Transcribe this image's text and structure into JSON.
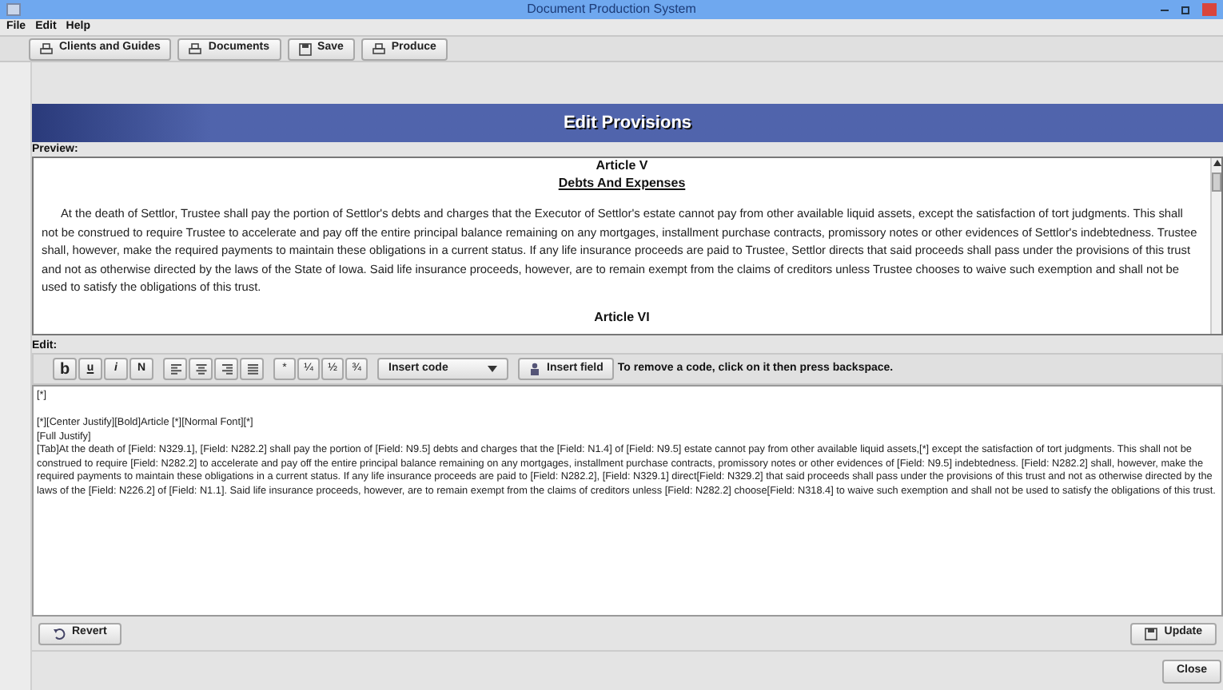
{
  "window": {
    "title": "Document Production System"
  },
  "menu": [
    "File",
    "Edit",
    "Help"
  ],
  "toolbar": [
    {
      "label": "Clients and Guides",
      "kind": "print"
    },
    {
      "label": "Documents",
      "kind": "print"
    },
    {
      "label": "Save",
      "kind": "save"
    },
    {
      "label": "Produce",
      "kind": "print"
    }
  ],
  "panel_title": "Edit Provisions",
  "preview": {
    "label": "Preview:",
    "heading": "Article V",
    "subheading": "Debts And Expenses",
    "paragraph": "At the death of Settlor, Trustee shall pay the portion of Settlor's debts and charges that the Executor of Settlor's estate cannot pay from other available liquid assets, except the satisfaction of tort judgments. This shall not be construed to require Trustee to accelerate and pay off the entire principal balance remaining on any mortgages, installment purchase contracts, promissory notes or other evidences of Settlor's indebtedness. Trustee shall, however, make the required payments to maintain these obligations in a current status. If any life insurance proceeds are paid to Trustee, Settlor directs that said proceeds shall pass under the provisions of this trust and not as otherwise directed by the laws of the State of Iowa. Said life insurance proceeds, however, are to remain exempt from the claims of creditors unless Trustee chooses to waive such exemption and shall not be used to satisfy the obligations of this trust.",
    "next_heading": "Article VI"
  },
  "edit": {
    "label": "Edit:",
    "format_buttons": [
      {
        "label": "b",
        "kind": "bold"
      },
      {
        "label": "u",
        "kind": "underline"
      },
      {
        "label": "i",
        "kind": "italic"
      },
      {
        "label": "N",
        "kind": "normal"
      }
    ],
    "align_buttons": [
      {
        "kind": "left"
      },
      {
        "kind": "center"
      },
      {
        "kind": "right"
      },
      {
        "kind": "justify"
      }
    ],
    "symbol_buttons": [
      "*",
      "¼",
      "½",
      "¾"
    ],
    "insert_code": "Insert code",
    "insert_field": "Insert field",
    "hint": "To remove a code, click on it then press backspace.",
    "lines": [
      "[*]",
      "[*][Center Justify][Bold]Article [*][Normal Font][*]",
      "[Full Justify]",
      "[Tab]At the death of [Field: N329.1], [Field: N282.2] shall pay the portion of [Field: N9.5] debts and charges that the [Field: N1.4] of [Field: N9.5] estate cannot pay from other available liquid assets,[*] except the satisfaction of tort judgments.  This shall not be construed to require [Field: N282.2] to accelerate and pay off the entire principal balance remaining on any mortgages, installment purchase contracts, promissory notes or other evidences of [Field: N9.5] indebtedness.  [Field: N282.2] shall, however, make the required payments to maintain these obligations in a current status.  If any life insurance proceeds are paid to [Field: N282.2], [Field: N329.1] direct[Field: N329.2] that said proceeds shall pass under the provisions of this trust and not as otherwise directed by the laws of the [Field: N226.2] of [Field: N1.1].  Said life insurance proceeds, however, are to remain exempt from the claims of creditors unless [Field: N282.2] choose[Field: N318.4] to waive such exemption and shall not be used to satisfy the obligations of this trust."
    ]
  },
  "buttons": {
    "revert": "Revert",
    "update": "Update",
    "close": "Close"
  }
}
